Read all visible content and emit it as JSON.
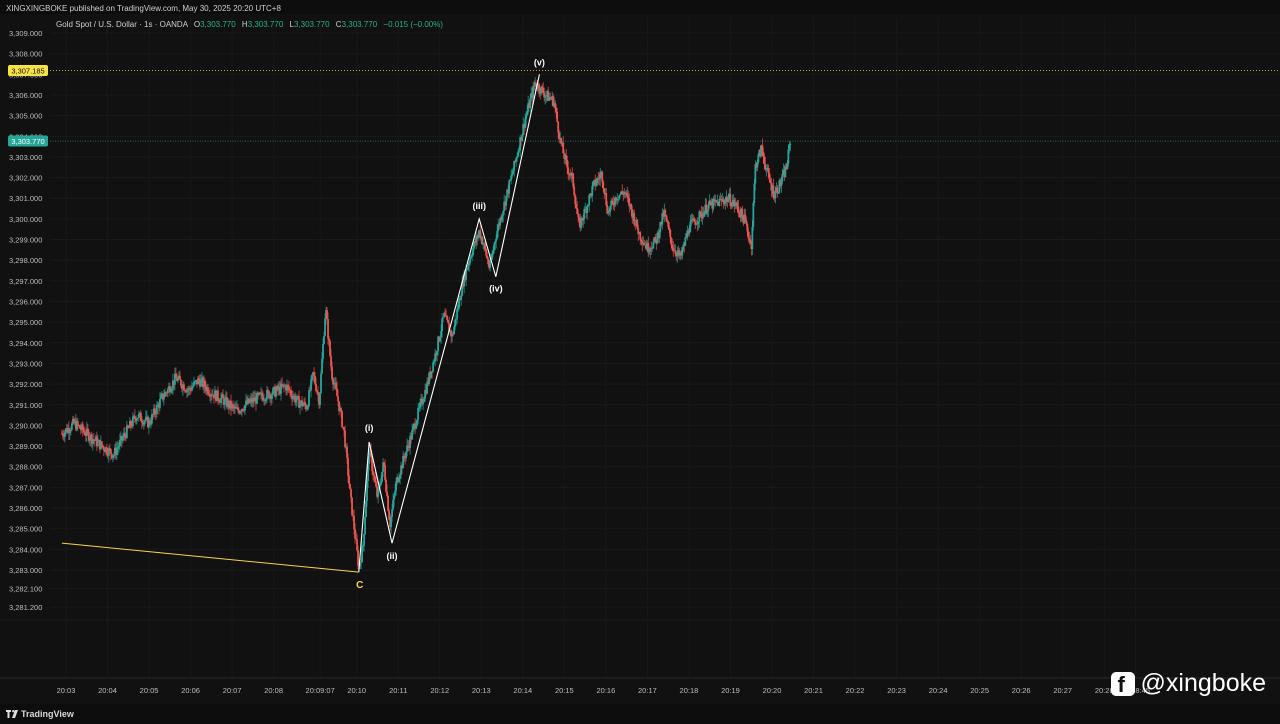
{
  "publish": "XINGXINGBOKE published on TradingView.com, May 30, 2025 20:20 UTC+8",
  "legend": {
    "symbol": "Gold Spot / U.S. Dollar · 1s · OANDA",
    "o_label": "O",
    "o": "3,303.770",
    "h_label": "H",
    "h": "3,303.770",
    "l_label": "L",
    "l": "3,303.770",
    "c_label": "C",
    "c": "3,303.770",
    "change": "−0.015 (−0.00%)"
  },
  "colors": {
    "up": "#26a69a",
    "down": "#ef5350",
    "wave_line": "#ffffff",
    "trend_line": "#f7d44a",
    "last_price_badge": "#26a69a",
    "marker_badge": "#f7e24a"
  },
  "chart_data": {
    "type": "candlestick",
    "symbol": "Gold Spot / U.S. Dollar",
    "interval": "1s",
    "ylim": [
      3281.2,
      3309.0
    ],
    "y_ticks": [
      "3,309.000",
      "3,308.000",
      "3,307.000",
      "3,306.000",
      "3,305.000",
      "3,304.000",
      "3,303.000",
      "3,302.000",
      "3,301.000",
      "3,300.000",
      "3,299.000",
      "3,298.000",
      "3,297.000",
      "3,296.000",
      "3,295.000",
      "3,294.000",
      "3,293.000",
      "3,292.000",
      "3,291.000",
      "3,290.000",
      "3,289.000",
      "3,288.000",
      "3,287.000",
      "3,286.000",
      "3,285.000",
      "3,284.000",
      "3,283.000",
      "3,282.100",
      "3,281.200"
    ],
    "y_tick_values": [
      3309,
      3308,
      3307,
      3306,
      3305,
      3304,
      3303,
      3302,
      3301,
      3300,
      3299,
      3298,
      3297,
      3296,
      3295,
      3294,
      3293,
      3292,
      3291,
      3290,
      3289,
      3288,
      3287,
      3286,
      3285,
      3284,
      3283,
      3282.1,
      3281.2
    ],
    "x_ticks": [
      "20:03",
      "20:04",
      "20:05",
      "20:06",
      "20:07",
      "20:08",
      "20:09:07",
      "20:10",
      "20:11",
      "20:12",
      "20:13",
      "20:14",
      "20:15",
      "20:16",
      "20:17",
      "20:18",
      "20:19",
      "20:20",
      "20:21",
      "20:22",
      "20:23",
      "20:24",
      "20:25",
      "20:26",
      "20:27",
      "20:28",
      "20:28:45"
    ],
    "x_tick_values": [
      3,
      4,
      5,
      6,
      7,
      8,
      9.12,
      10,
      11,
      12,
      13,
      14,
      15,
      16,
      17,
      18,
      19,
      20,
      21,
      22,
      23,
      24,
      25,
      26,
      27,
      28,
      28.75
    ],
    "x_range_minutes": [
      2.85,
      29.6
    ],
    "price_path": [
      [
        2.9,
        3289.6
      ],
      [
        3.2,
        3290.1
      ],
      [
        3.5,
        3289.6
      ],
      [
        3.8,
        3289.1
      ],
      [
        4.15,
        3288.6
      ],
      [
        4.4,
        3289.5
      ],
      [
        4.7,
        3290.5
      ],
      [
        5.0,
        3290.1
      ],
      [
        5.3,
        3291.3
      ],
      [
        5.65,
        3292.3
      ],
      [
        5.95,
        3291.7
      ],
      [
        6.2,
        3292.2
      ],
      [
        6.5,
        3291.6
      ],
      [
        6.8,
        3291.2
      ],
      [
        7.1,
        3290.7
      ],
      [
        7.4,
        3291.1
      ],
      [
        7.7,
        3291.4
      ],
      [
        8.0,
        3291.6
      ],
      [
        8.3,
        3291.9
      ],
      [
        8.55,
        3291.2
      ],
      [
        8.8,
        3290.9
      ],
      [
        8.95,
        3292.5
      ],
      [
        9.1,
        3291.2
      ],
      [
        9.25,
        3295.7
      ],
      [
        9.4,
        3292.5
      ],
      [
        9.55,
        3291.2
      ],
      [
        9.7,
        3289.6
      ],
      [
        9.85,
        3286.5
      ],
      [
        9.97,
        3284.5
      ],
      [
        10.05,
        3283.1
      ],
      [
        10.15,
        3284.1
      ],
      [
        10.3,
        3288.8
      ],
      [
        10.5,
        3286.5
      ],
      [
        10.65,
        3288.2
      ],
      [
        10.8,
        3285.2
      ],
      [
        10.95,
        3287.2
      ],
      [
        11.15,
        3288.5
      ],
      [
        11.3,
        3289.4
      ],
      [
        11.45,
        3290.4
      ],
      [
        11.7,
        3292.0
      ],
      [
        11.9,
        3293.5
      ],
      [
        12.1,
        3295.3
      ],
      [
        12.3,
        3294.3
      ],
      [
        12.55,
        3296.9
      ],
      [
        12.75,
        3298.3
      ],
      [
        12.95,
        3299.4
      ],
      [
        13.05,
        3298.8
      ],
      [
        13.2,
        3297.6
      ],
      [
        13.35,
        3299.2
      ],
      [
        13.55,
        3300.7
      ],
      [
        13.8,
        3302.6
      ],
      [
        14.05,
        3304.8
      ],
      [
        14.3,
        3306.6
      ],
      [
        14.55,
        3306.0
      ],
      [
        14.75,
        3305.7
      ],
      [
        14.9,
        3303.8
      ],
      [
        15.05,
        3302.6
      ],
      [
        15.2,
        3301.9
      ],
      [
        15.35,
        3299.6
      ],
      [
        15.5,
        3300.4
      ],
      [
        15.7,
        3301.6
      ],
      [
        15.9,
        3302.2
      ],
      [
        16.05,
        3300.3
      ],
      [
        16.25,
        3301.1
      ],
      [
        16.45,
        3301.3
      ],
      [
        16.6,
        3300.5
      ],
      [
        16.8,
        3299.3
      ],
      [
        17.0,
        3298.6
      ],
      [
        17.2,
        3298.9
      ],
      [
        17.4,
        3300.3
      ],
      [
        17.6,
        3298.7
      ],
      [
        17.8,
        3298.1
      ],
      [
        18.0,
        3299.6
      ],
      [
        18.2,
        3300.0
      ],
      [
        18.45,
        3300.6
      ],
      [
        18.7,
        3300.8
      ],
      [
        18.95,
        3301.0
      ],
      [
        19.15,
        3300.6
      ],
      [
        19.35,
        3299.9
      ],
      [
        19.5,
        3298.7
      ],
      [
        19.6,
        3302.6
      ],
      [
        19.75,
        3303.4
      ],
      [
        19.9,
        3302.1
      ],
      [
        20.05,
        3301.2
      ],
      [
        20.2,
        3301.7
      ],
      [
        20.35,
        3302.5
      ],
      [
        20.45,
        3303.9
      ]
    ],
    "annotations": [
      {
        "label": "(i)",
        "x": 10.3,
        "y": 3289.2
      },
      {
        "label": "(ii)",
        "x": 10.85,
        "y": 3284.3
      },
      {
        "label": "(iii)",
        "x": 12.95,
        "y": 3300.0
      },
      {
        "label": "(iv)",
        "x": 13.35,
        "y": 3297.2
      },
      {
        "label": "(v)",
        "x": 14.4,
        "y": 3307.0
      },
      {
        "label": "C",
        "x": 10.05,
        "y": 3282.9
      }
    ],
    "wave_path": [
      [
        10.05,
        3282.9
      ],
      [
        10.3,
        3289.2
      ],
      [
        10.85,
        3284.3
      ],
      [
        12.95,
        3300.0
      ],
      [
        13.35,
        3297.2
      ],
      [
        14.4,
        3307.0
      ]
    ],
    "trend_line": [
      [
        2.9,
        3284.3
      ],
      [
        10.05,
        3282.9
      ]
    ],
    "horizontal_lines": [
      {
        "price": 3307.185,
        "label": "3,307.185"
      },
      {
        "price": 3303.77,
        "label": "3,303.770"
      }
    ],
    "current_price": "3,303.770",
    "marker_price": "3,307.185"
  },
  "footer": {
    "brand": "TradingView"
  },
  "watermark": {
    "handle": "@xingboke"
  }
}
